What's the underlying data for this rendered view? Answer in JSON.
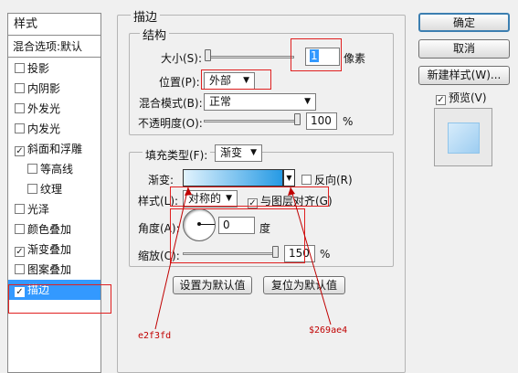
{
  "sidebar": {
    "header": "样式",
    "blend_options": "混合选项:默认",
    "items": [
      {
        "label": "投影",
        "checked": false
      },
      {
        "label": "内阴影",
        "checked": false
      },
      {
        "label": "外发光",
        "checked": false
      },
      {
        "label": "内发光",
        "checked": false
      },
      {
        "label": "斜面和浮雕",
        "checked": true
      },
      {
        "label": "等高线",
        "checked": false
      },
      {
        "label": "纹理",
        "checked": false
      },
      {
        "label": "光泽",
        "checked": false
      },
      {
        "label": "颜色叠加",
        "checked": false
      },
      {
        "label": "渐变叠加",
        "checked": true
      },
      {
        "label": "图案叠加",
        "checked": false
      },
      {
        "label": "描边",
        "checked": true
      }
    ]
  },
  "stroke": {
    "title": "描边",
    "structure": {
      "title": "结构",
      "size_label": "大小(S):",
      "size_value": "1",
      "size_unit": "像素",
      "position_label": "位置(P):",
      "position_value": "外部",
      "blend_label": "混合模式(B):",
      "blend_value": "正常",
      "opacity_label": "不透明度(O):",
      "opacity_value": "100",
      "opacity_unit": "%"
    },
    "fill": {
      "fill_type_label": "填充类型(F):",
      "fill_type_value": "渐变",
      "gradient_label": "渐变:",
      "gradient_start": "#e2f3fd",
      "gradient_end": "#269ae4",
      "reverse_label": "反向(R)",
      "style_label": "样式(L):",
      "style_value": "对称的",
      "align_label": "与图层对齐(G)",
      "angle_label": "角度(A):",
      "angle_value": "0",
      "angle_unit": "度",
      "scale_label": "缩放(C):",
      "scale_value": "150",
      "scale_unit": "%"
    },
    "set_default_label": "设置为默认值",
    "reset_default_label": "复位为默认值"
  },
  "buttons": {
    "ok": "确定",
    "cancel": "取消",
    "new_style": "新建样式(W)...",
    "preview": "预览(V)"
  },
  "annotations": {
    "start_color": "e2f3fd",
    "end_color": "$269ae4"
  },
  "colors": {
    "accent": "#3399ff",
    "highlight": "#e02020"
  }
}
